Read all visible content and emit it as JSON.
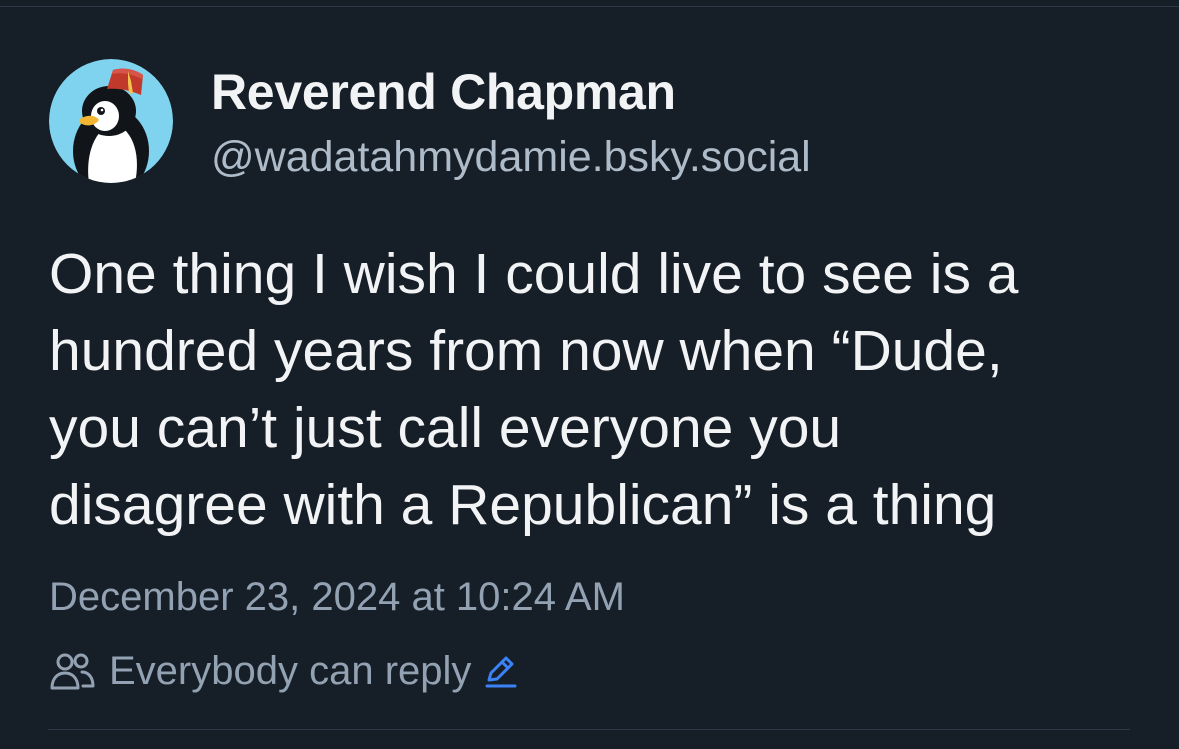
{
  "post": {
    "author": {
      "display_name": "Reverend Chapman",
      "handle": "@wadatahmydamie.bsky.social",
      "avatar_icon": "penguin-fez-avatar"
    },
    "text": "One thing I wish I could live to see is a\nhundred years from now when “Dude,\nyou can’t just call everyone you\ndisagree with a Republican” is a thing",
    "timestamp": "December 23, 2024 at 10:24 AM",
    "reply_setting": {
      "label": "Everybody can reply",
      "icon": "people-icon",
      "edit_icon": "pencil-edit-icon"
    }
  },
  "colors": {
    "background": "#161e27",
    "primary_text": "#f1f3f5",
    "secondary_text": "#93a2b3",
    "accent": "#3b82f6"
  }
}
